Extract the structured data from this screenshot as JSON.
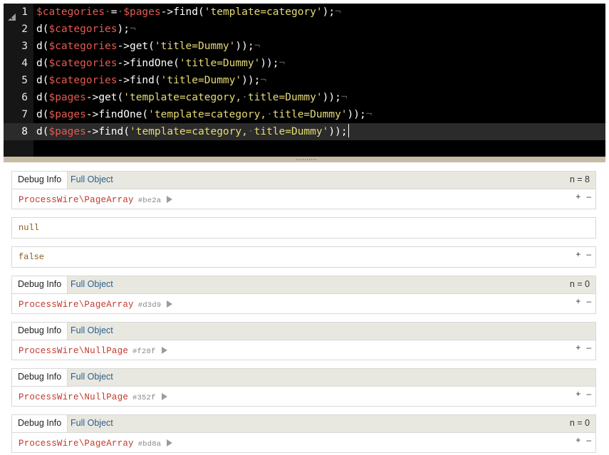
{
  "editor": {
    "lines": [
      {
        "num": "1",
        "active": false,
        "tokens": [
          [
            "var",
            "$categories"
          ],
          [
            "dot",
            "·"
          ],
          [
            "op",
            "="
          ],
          [
            "dot",
            "·"
          ],
          [
            "var",
            "$pages"
          ],
          [
            "op",
            "->"
          ],
          [
            "pun",
            "find("
          ],
          [
            "str",
            "'template=category'"
          ],
          [
            "pun",
            ");"
          ],
          [
            "eol",
            "¬"
          ]
        ]
      },
      {
        "num": "2",
        "active": false,
        "tokens": [
          [
            "pun",
            "d("
          ],
          [
            "var",
            "$categories"
          ],
          [
            "pun",
            ");"
          ],
          [
            "eol",
            "¬"
          ]
        ]
      },
      {
        "num": "3",
        "active": false,
        "tokens": [
          [
            "pun",
            "d("
          ],
          [
            "var",
            "$categories"
          ],
          [
            "op",
            "->"
          ],
          [
            "pun",
            "get("
          ],
          [
            "str",
            "'title=Dummy'"
          ],
          [
            "pun",
            "));"
          ],
          [
            "eol",
            "¬"
          ]
        ]
      },
      {
        "num": "4",
        "active": false,
        "tokens": [
          [
            "pun",
            "d("
          ],
          [
            "var",
            "$categories"
          ],
          [
            "op",
            "->"
          ],
          [
            "pun",
            "findOne("
          ],
          [
            "str",
            "'title=Dummy'"
          ],
          [
            "pun",
            "));"
          ],
          [
            "eol",
            "¬"
          ]
        ]
      },
      {
        "num": "5",
        "active": false,
        "tokens": [
          [
            "pun",
            "d("
          ],
          [
            "var",
            "$categories"
          ],
          [
            "op",
            "->"
          ],
          [
            "pun",
            "find("
          ],
          [
            "str",
            "'title=Dummy'"
          ],
          [
            "pun",
            "));"
          ],
          [
            "eol",
            "¬"
          ]
        ]
      },
      {
        "num": "6",
        "active": false,
        "tokens": [
          [
            "pun",
            "d("
          ],
          [
            "var",
            "$pages"
          ],
          [
            "op",
            "->"
          ],
          [
            "pun",
            "get("
          ],
          [
            "str",
            "'template=category,"
          ],
          [
            "dot",
            "·"
          ],
          [
            "str",
            "title=Dummy'"
          ],
          [
            "pun",
            "));"
          ],
          [
            "eol",
            "¬"
          ]
        ]
      },
      {
        "num": "7",
        "active": false,
        "tokens": [
          [
            "pun",
            "d("
          ],
          [
            "var",
            "$pages"
          ],
          [
            "op",
            "->"
          ],
          [
            "pun",
            "findOne("
          ],
          [
            "str",
            "'template=category,"
          ],
          [
            "dot",
            "·"
          ],
          [
            "str",
            "title=Dummy'"
          ],
          [
            "pun",
            "));"
          ],
          [
            "eol",
            "¬"
          ]
        ]
      },
      {
        "num": "8",
        "active": true,
        "tokens": [
          [
            "pun",
            "d("
          ],
          [
            "var",
            "$pages"
          ],
          [
            "op",
            "->"
          ],
          [
            "pun",
            "find("
          ],
          [
            "str",
            "'template=category,"
          ],
          [
            "dot",
            "·"
          ],
          [
            "str",
            "title=Dummy'"
          ],
          [
            "pun",
            "));"
          ]
        ]
      }
    ]
  },
  "output": {
    "tab_debug_label": "Debug Info",
    "tab_full_label": "Full Object",
    "expand_label": "+",
    "collapse_label": "–",
    "entries": [
      {
        "kind": "object",
        "cls": "ProcessWire\\PageArray",
        "hash": "#be2a",
        "count": "n = 8"
      },
      {
        "kind": "value",
        "text": "null",
        "controls": false
      },
      {
        "kind": "value",
        "text": "false",
        "controls": true
      },
      {
        "kind": "object",
        "cls": "ProcessWire\\PageArray",
        "hash": "#d3d9",
        "count": "n = 0"
      },
      {
        "kind": "object",
        "cls": "ProcessWire\\NullPage",
        "hash": "#f28f",
        "count": ""
      },
      {
        "kind": "object",
        "cls": "ProcessWire\\NullPage",
        "hash": "#352f",
        "count": ""
      },
      {
        "kind": "object",
        "cls": "ProcessWire\\PageArray",
        "hash": "#bd8a",
        "count": "n = 0"
      }
    ]
  },
  "colors": {
    "variable": "#e35b4f",
    "string": "#e6db74",
    "class_name": "#c0392b",
    "link_tab": "#2e5e8c",
    "value": "#8a5a1c"
  }
}
